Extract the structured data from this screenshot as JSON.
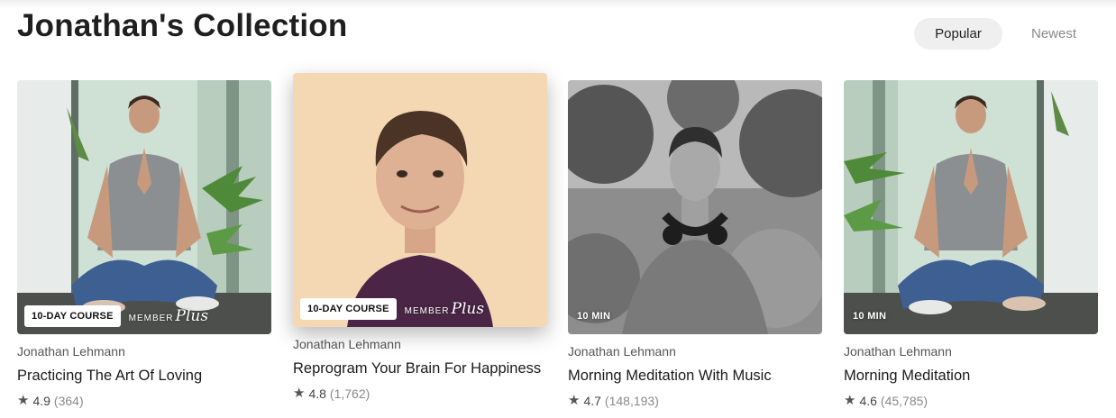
{
  "header": {
    "title": "Jonathan's Collection"
  },
  "sort": {
    "popular": "Popular",
    "newest": "Newest"
  },
  "cards": [
    {
      "tag": "10-DAY COURSE",
      "member": "MEMBER",
      "plus": "Plus",
      "author": "Jonathan Lehmann",
      "title": "Practicing The Art Of Loving",
      "rating": "4.9",
      "count": "(364)"
    },
    {
      "tag": "10-DAY COURSE",
      "member": "MEMBER",
      "plus": "Plus",
      "author": "Jonathan Lehmann",
      "title": "Reprogram Your Brain For Happiness",
      "rating": "4.8",
      "count": "(1,762)"
    },
    {
      "tag": "10 MIN",
      "author": "Jonathan Lehmann",
      "title": "Morning Meditation With Music",
      "rating": "4.7",
      "count": "(148,193)"
    },
    {
      "tag": "10 MIN",
      "author": "Jonathan Lehmann",
      "title": "Morning Meditation",
      "rating": "4.6",
      "count": "(45,785)"
    }
  ],
  "icons": {
    "rating": "star-icon"
  },
  "colors": {
    "active_sort_bg": "#efefef",
    "inactive_sort_text": "#8a8a8a"
  }
}
